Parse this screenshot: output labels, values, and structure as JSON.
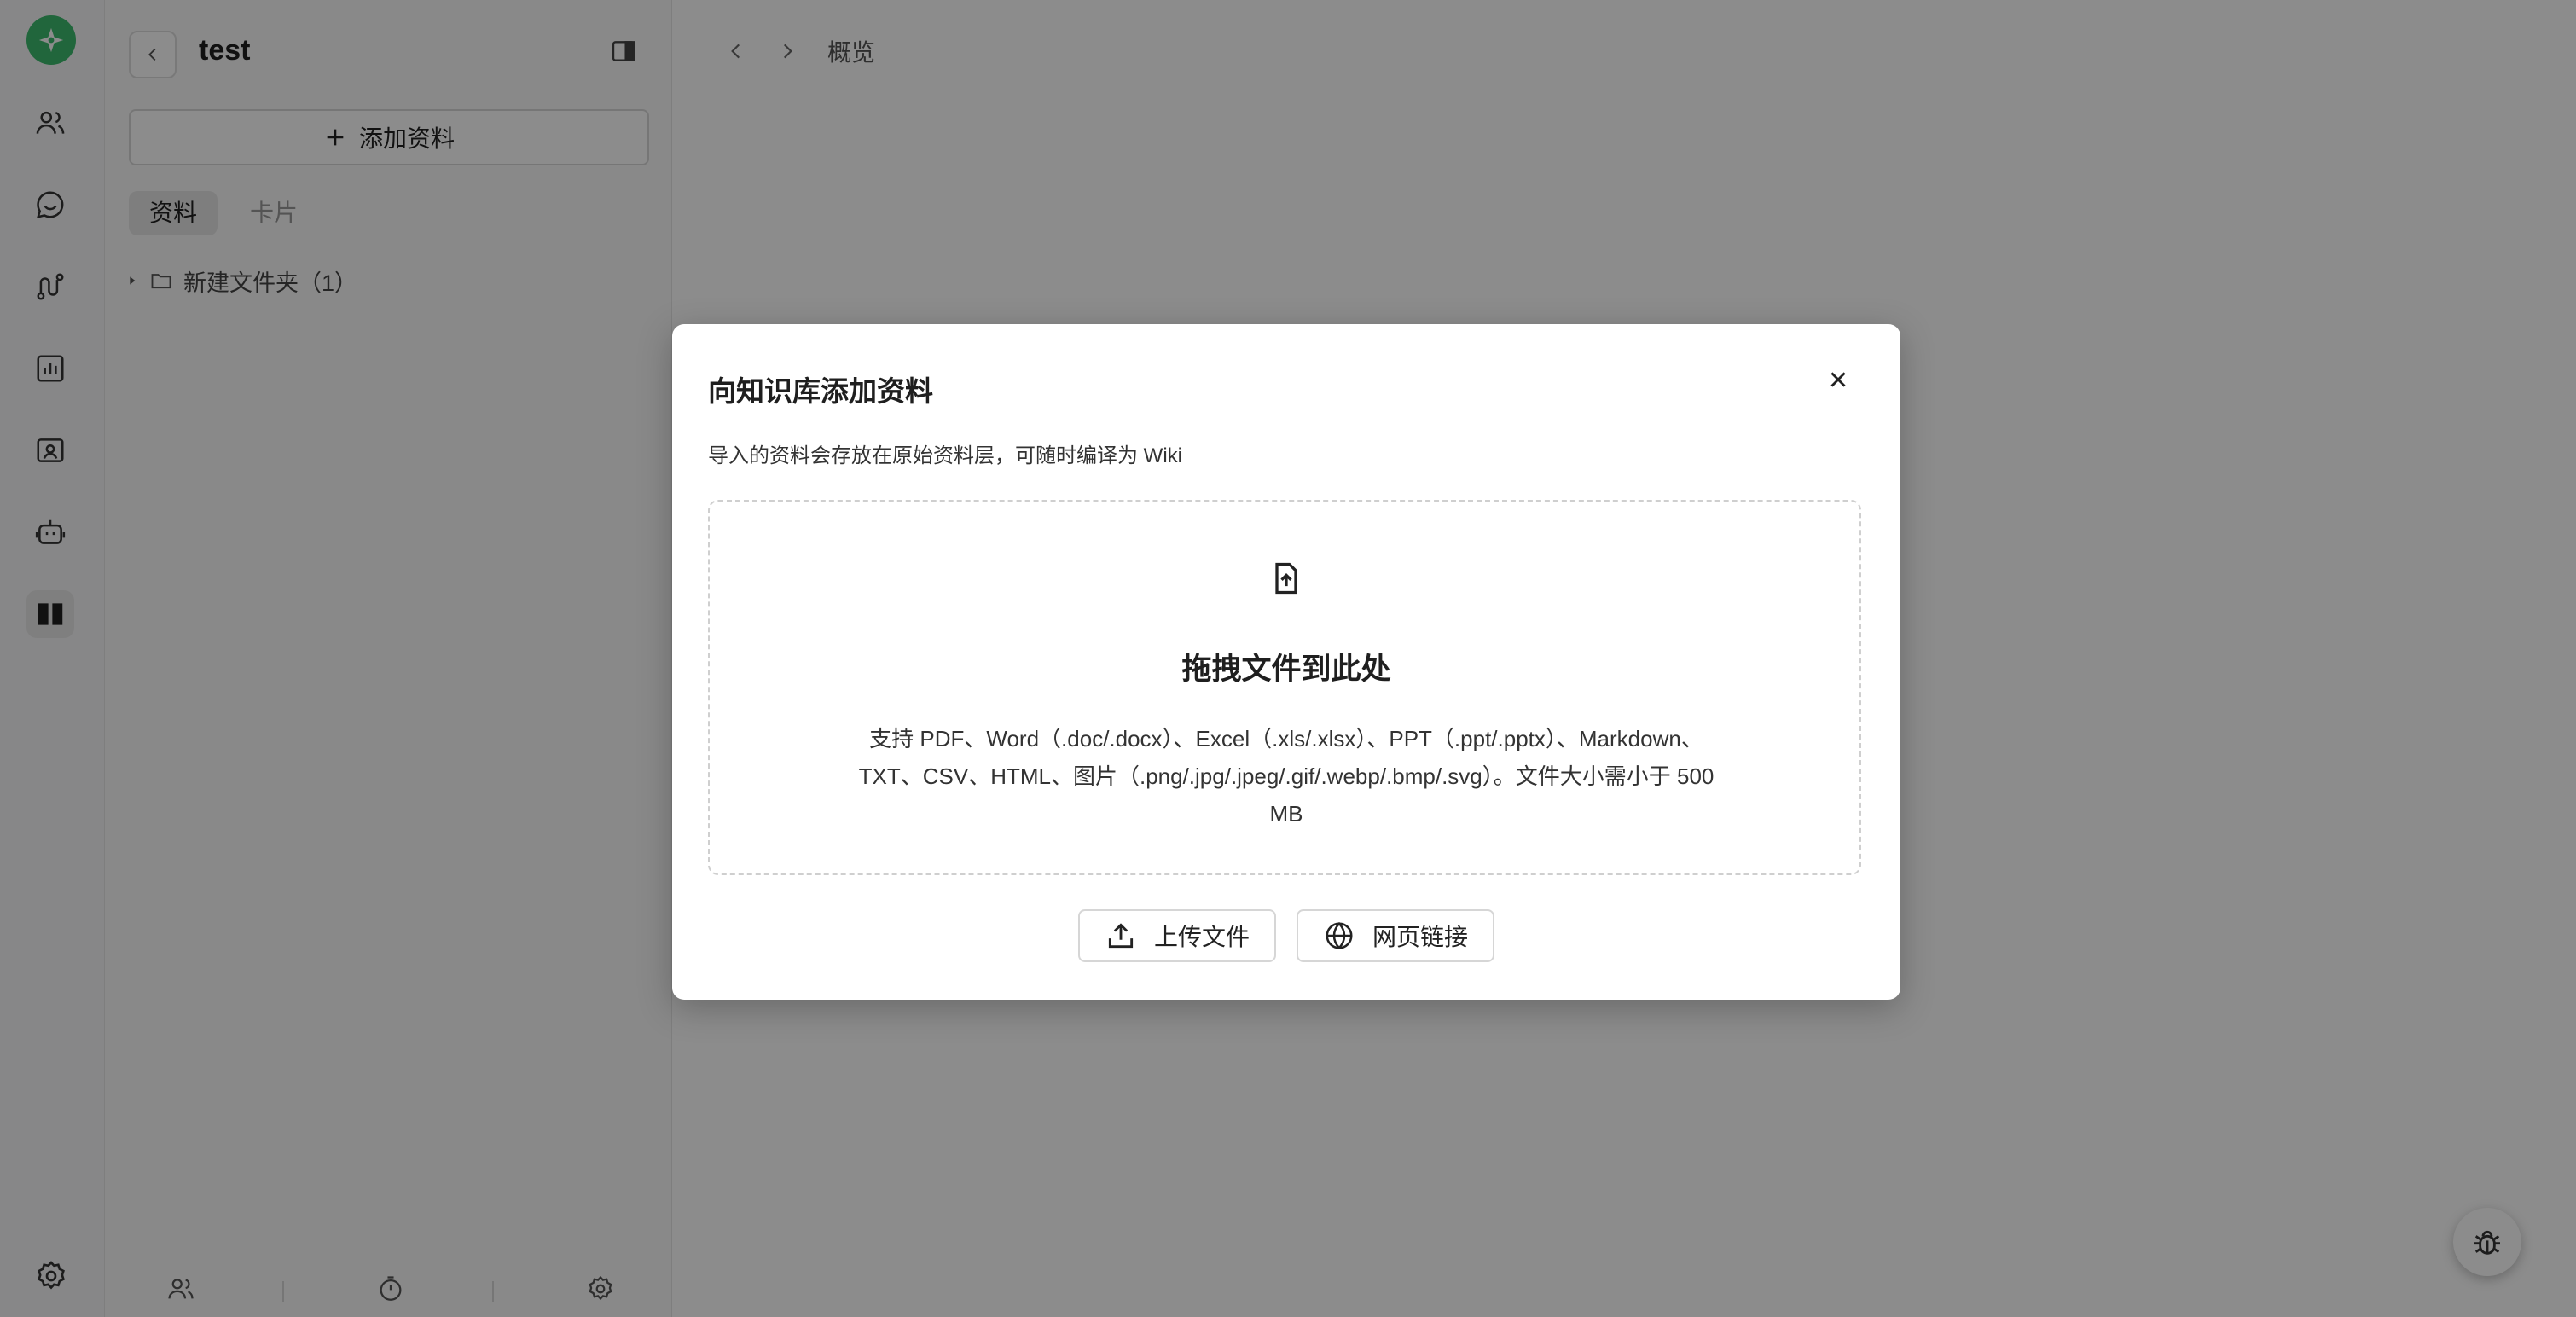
{
  "sidebar": {
    "title": "test",
    "add_button_label": "添加资料",
    "tabs": [
      {
        "label": "资料",
        "active": true
      },
      {
        "label": "卡片",
        "active": false
      }
    ],
    "tree": [
      {
        "label": "新建文件夹（1）",
        "type": "folder",
        "expanded": false
      }
    ]
  },
  "main": {
    "breadcrumb": "概览"
  },
  "modal": {
    "title": "向知识库添加资料",
    "description": "导入的资料会存放在原始资料层，可随时编译为 Wiki",
    "dropzone": {
      "title": "拖拽文件到此处",
      "description": "支持 PDF、Word（.doc/.docx）、Excel（.xls/.xlsx）、PPT（.ppt/.pptx）、Markdown、TXT、CSV、HTML、图片（.png/.jpg/.jpeg/.gif/.webp/.bmp/.svg）。文件大小需小于 500 MB"
    },
    "buttons": {
      "upload": "上传文件",
      "link": "网页链接"
    }
  },
  "colors": {
    "brand": "#3dbb6e",
    "overlay": "rgba(0,0,0,0.45)"
  },
  "icons": {
    "rail": [
      "users-icon",
      "chat-icon",
      "workflow-icon",
      "chart-icon",
      "contact-card-icon",
      "robot-icon",
      "book-icon",
      "settings-icon"
    ],
    "panel_bottom": [
      "users-icon",
      "timer-icon",
      "settings-icon"
    ]
  }
}
